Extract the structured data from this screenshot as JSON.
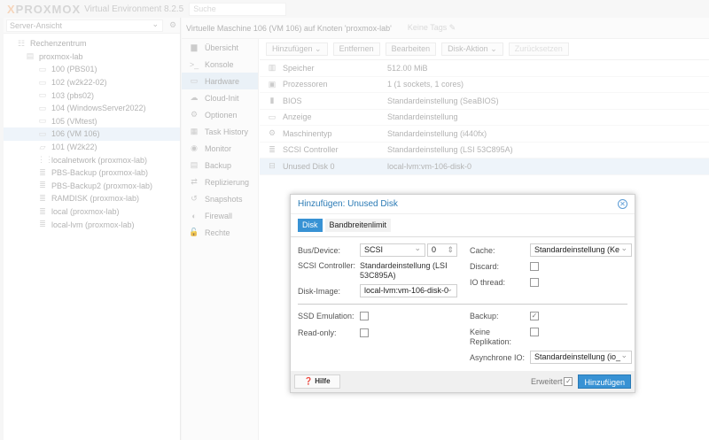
{
  "top": {
    "logo": "PROXMOX",
    "version": "Virtual Environment 8.2.5",
    "search_placeholder": "Suche"
  },
  "tree": {
    "view": "Server-Ansicht",
    "items": [
      {
        "label": "Rechenzentrum",
        "icon": "datacenter-icon"
      },
      {
        "label": "proxmox-lab",
        "icon": "node-icon"
      },
      {
        "label": "100 (PBS01)",
        "icon": "vm-icon"
      },
      {
        "label": "102 (w2k22-02)",
        "icon": "vm-icon"
      },
      {
        "label": "103 (pbs02)",
        "icon": "vm-icon"
      },
      {
        "label": "104 (WindowsServer2022)",
        "icon": "vm-icon"
      },
      {
        "label": "105 (VMtest)",
        "icon": "vm-icon"
      },
      {
        "label": "106 (VM 106)",
        "icon": "vm-icon"
      },
      {
        "label": "101 (W2k22)",
        "icon": "template-icon"
      },
      {
        "label": "localnetwork (proxmox-lab)",
        "icon": "network-icon"
      },
      {
        "label": "PBS-Backup (proxmox-lab)",
        "icon": "storage-icon"
      },
      {
        "label": "PBS-Backup2 (proxmox-lab)",
        "icon": "storage-icon"
      },
      {
        "label": "RAMDISK (proxmox-lab)",
        "icon": "storage-icon"
      },
      {
        "label": "local (proxmox-lab)",
        "icon": "storage-icon"
      },
      {
        "label": "local-lvm (proxmox-lab)",
        "icon": "storage-icon"
      }
    ]
  },
  "header": {
    "title": "Virtuelle Maschine 106 (VM 106) auf Knoten 'proxmox-lab'",
    "tags": "Keine Tags"
  },
  "nav": [
    "Übersicht",
    "Konsole",
    "Hardware",
    "Cloud-Init",
    "Optionen",
    "Task History",
    "Monitor",
    "Backup",
    "Replizierung",
    "Snapshots",
    "Firewall",
    "Rechte"
  ],
  "toolbar": {
    "add": "Hinzufügen",
    "remove": "Entfernen",
    "edit": "Bearbeiten",
    "disk_action": "Disk-Aktion",
    "revert": "Zurücksetzen"
  },
  "hardware": [
    {
      "key": "Speicher",
      "value": "512.00 MiB"
    },
    {
      "key": "Prozessoren",
      "value": "1 (1 sockets, 1 cores)"
    },
    {
      "key": "BIOS",
      "value": "Standardeinstellung (SeaBIOS)"
    },
    {
      "key": "Anzeige",
      "value": "Standardeinstellung"
    },
    {
      "key": "Maschinentyp",
      "value": "Standardeinstellung (i440fx)"
    },
    {
      "key": "SCSI Controller",
      "value": "Standardeinstellung (LSI 53C895A)"
    },
    {
      "key": "Unused Disk 0",
      "value": "local-lvm:vm-106-disk-0"
    }
  ],
  "dialog": {
    "title": "Hinzufügen: Unused Disk",
    "tabs": [
      "Disk",
      "Bandbreitenlimit"
    ],
    "bus_label": "Bus/Device:",
    "bus": "SCSI",
    "device": "0",
    "scsi_label": "SCSI Controller:",
    "scsi": "Standardeinstellung (LSI 53C895A)",
    "image_label": "Disk-Image:",
    "image": "local-lvm:vm-106-disk-0",
    "cache_label": "Cache:",
    "cache": "Standardeinstellung (Ke",
    "discard_label": "Discard:",
    "iothread_label": "IO thread:",
    "ssd_label": "SSD Emulation:",
    "readonly_label": "Read-only:",
    "backup_label": "Backup:",
    "norep_label": "Keine Replikation:",
    "aio_label": "Asynchrone IO:",
    "aio": "Standardeinstellung (io_",
    "help": "Hilfe",
    "advanced": "Erweitert",
    "submit": "Hinzufügen",
    "backup_checked": true,
    "advanced_checked": true
  }
}
